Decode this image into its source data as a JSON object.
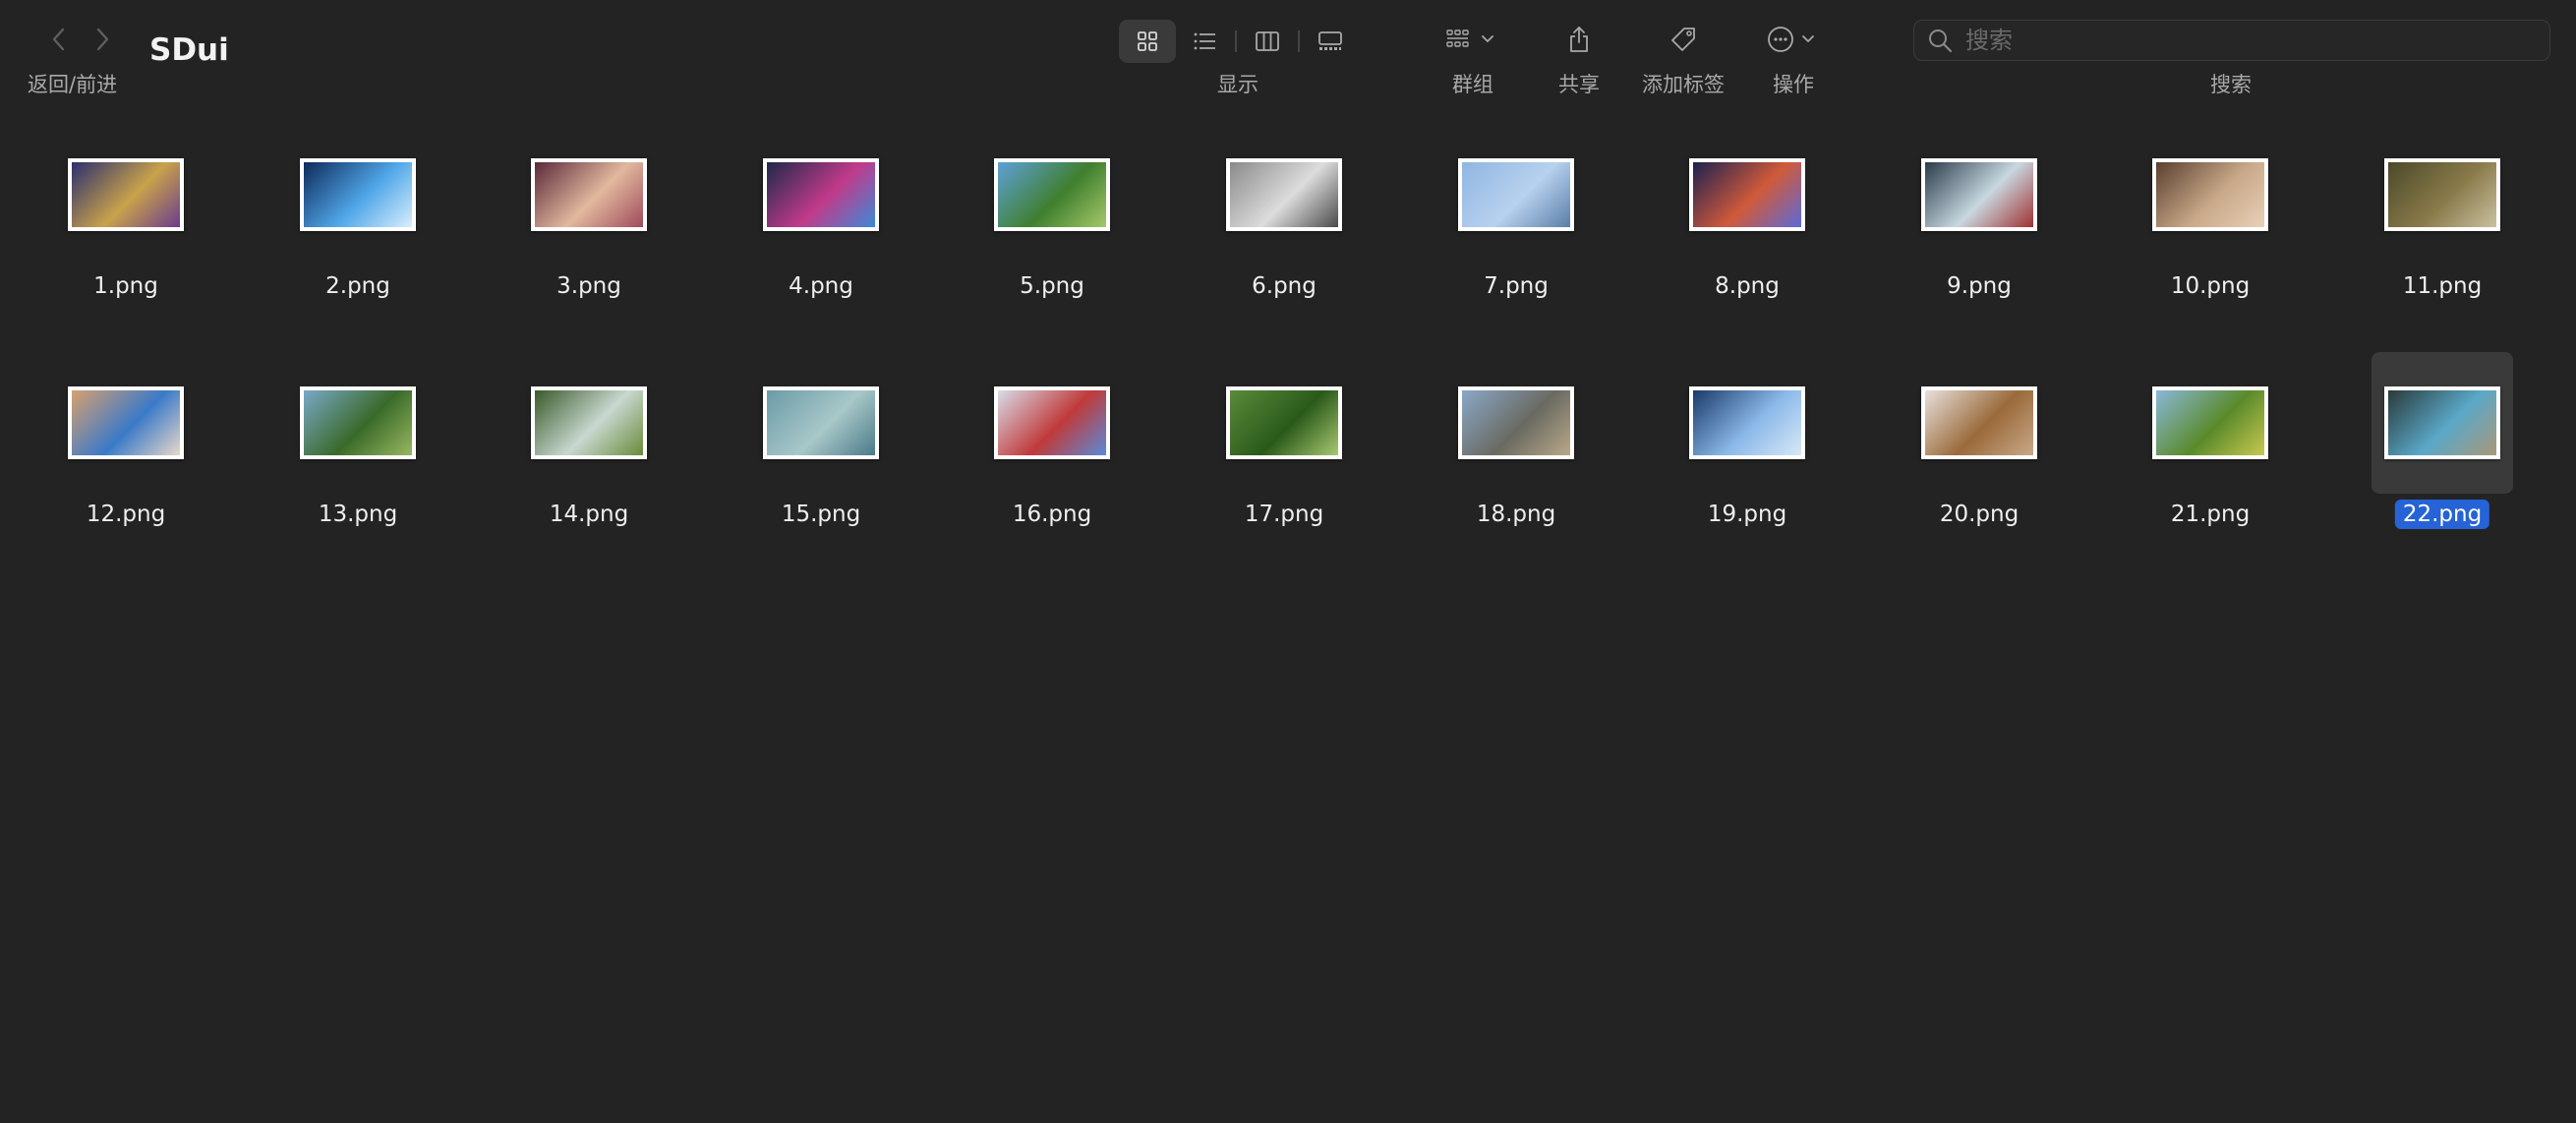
{
  "toolbar": {
    "nav_label": "返回/前进",
    "folder_title": "SDui",
    "view_label": "显示",
    "group_label": "群组",
    "share_label": "共享",
    "tag_label": "添加标签",
    "action_label": "操作",
    "search_placeholder": "搜索",
    "search_label": "搜索",
    "icons": {
      "back": "chevron-left-icon",
      "forward": "chevron-right-icon",
      "views": [
        "icon-view-icon",
        "list-view-icon",
        "column-view-icon",
        "gallery-view-icon"
      ],
      "group": "group-grid-icon",
      "share": "share-icon",
      "tag": "tag-icon",
      "action": "ellipsis-circle-icon",
      "search": "magnifier-icon"
    },
    "active_view": "icon-view"
  },
  "files": [
    {
      "name": "1.png",
      "colors": [
        "#2b2f6e",
        "#c9a24a",
        "#6a3c8c"
      ]
    },
    {
      "name": "2.png",
      "colors": [
        "#0f2a5a",
        "#4fa6e8",
        "#d9eefc"
      ]
    },
    {
      "name": "3.png",
      "colors": [
        "#5a2a3a",
        "#e2b89e",
        "#a04a5c"
      ]
    },
    {
      "name": "4.png",
      "colors": [
        "#1e2a4a",
        "#c23a8a",
        "#3a8ad8"
      ]
    },
    {
      "name": "5.png",
      "colors": [
        "#5ea0d8",
        "#3f7f2e",
        "#a6c86a"
      ]
    },
    {
      "name": "6.png",
      "colors": [
        "#8a8a8a",
        "#dcdcdc",
        "#4a4a4a"
      ]
    },
    {
      "name": "7.png",
      "colors": [
        "#8fb6e2",
        "#b7d1ee",
        "#5a7ea8"
      ]
    },
    {
      "name": "8.png",
      "colors": [
        "#1d2150",
        "#d05a3a",
        "#5a6ad8"
      ]
    },
    {
      "name": "9.png",
      "colors": [
        "#2a3a4a",
        "#c8d8e0",
        "#a03030"
      ]
    },
    {
      "name": "10.png",
      "colors": [
        "#5a4030",
        "#c8a888",
        "#e8d0b8"
      ]
    },
    {
      "name": "11.png",
      "colors": [
        "#4a4a2a",
        "#8a7a4a",
        "#c8c0a0"
      ]
    },
    {
      "name": "12.png",
      "colors": [
        "#d8a070",
        "#3a7ac8",
        "#e8d8c8"
      ]
    },
    {
      "name": "13.png",
      "colors": [
        "#7aa8c8",
        "#3a6a2a",
        "#98b860"
      ]
    },
    {
      "name": "14.png",
      "colors": [
        "#3a5a2a",
        "#c8d8d0",
        "#6a8a3a"
      ]
    },
    {
      "name": "15.png",
      "colors": [
        "#6a9aa8",
        "#a8c8c8",
        "#4a7a88"
      ]
    },
    {
      "name": "16.png",
      "colors": [
        "#d8dce8",
        "#c03a3a",
        "#5a8ad8"
      ]
    },
    {
      "name": "17.png",
      "colors": [
        "#5a8a3a",
        "#2a5a1a",
        "#a8c870"
      ]
    },
    {
      "name": "18.png",
      "colors": [
        "#8aa8c8",
        "#6a6a62",
        "#b8a888"
      ]
    },
    {
      "name": "19.png",
      "colors": [
        "#1a3a6a",
        "#8ab8e8",
        "#d8e8f8"
      ]
    },
    {
      "name": "20.png",
      "colors": [
        "#e8e0dc",
        "#9a6a3a",
        "#c8a888"
      ]
    },
    {
      "name": "21.png",
      "colors": [
        "#8ab8d8",
        "#5a8a2a",
        "#c8c850"
      ]
    },
    {
      "name": "22.png",
      "colors": [
        "#2a3a3a",
        "#5aa8c8",
        "#a89878"
      ],
      "selected": true
    }
  ]
}
